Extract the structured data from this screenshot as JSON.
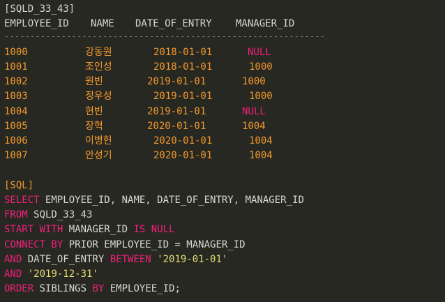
{
  "table_name": "[SQLD_33_43]",
  "headers": [
    "EMPLOYEE_ID",
    "NAME",
    "DATE_OF_ENTRY",
    "MANAGER_ID"
  ],
  "separator": "--------------------------------------------------------------",
  "rows": [
    {
      "id": "1000",
      "name": "강동원",
      "date": "2018-01-01",
      "mgr": "NULL"
    },
    {
      "id": "1001",
      "name": "조인성",
      "date": "2018-01-01",
      "mgr": "1000"
    },
    {
      "id": "1002",
      "name": "원빈",
      "date": "2019-01-01",
      "mgr": "1000"
    },
    {
      "id": "1003",
      "name": "정우성",
      "date": "2019-01-01",
      "mgr": "1000"
    },
    {
      "id": "1004",
      "name": "현빈",
      "date": "2019-01-01",
      "mgr": "NULL"
    },
    {
      "id": "1005",
      "name": "장혁",
      "date": "2020-01-01",
      "mgr": "1004"
    },
    {
      "id": "1006",
      "name": "이병헌",
      "date": "2020-01-01",
      "mgr": "1004"
    },
    {
      "id": "1007",
      "name": "안성기",
      "date": "2020-01-01",
      "mgr": "1004"
    }
  ],
  "sql_label": "[SQL]",
  "sql": {
    "l1_kw": "SELECT",
    "l1_rest": " EMPLOYEE_ID, NAME, DATE_OF_ENTRY, MANAGER_ID",
    "l2_kw": "FROM",
    "l2_rest": " SQLD_33_43",
    "l3_kw": "START WITH",
    "l3_mid": " MANAGER_ID ",
    "l3_kw2": "IS NULL",
    "l4_kw": "CONNECT BY",
    "l4_rest": " PRIOR EMPLOYEE_ID = MANAGER_ID",
    "l5_kw": "AND",
    "l5_mid": " DATE_OF_ENTRY ",
    "l5_kw2": "BETWEEN",
    "l5_sp": " ",
    "l5_str": "'2019-01-01'",
    "l6_kw": "AND",
    "l6_sp": " ",
    "l6_str": "'2019-12-31'",
    "l7_kw": "ORDER",
    "l7_mid": " SIBLINGS ",
    "l7_kw2": "BY",
    "l7_rest": " EMPLOYEE_ID;"
  },
  "colors": {
    "background": "#272822",
    "keyword": "#f0207a",
    "number": "#f2992e",
    "string": "#e6db74",
    "text": "#d8d8d0"
  }
}
